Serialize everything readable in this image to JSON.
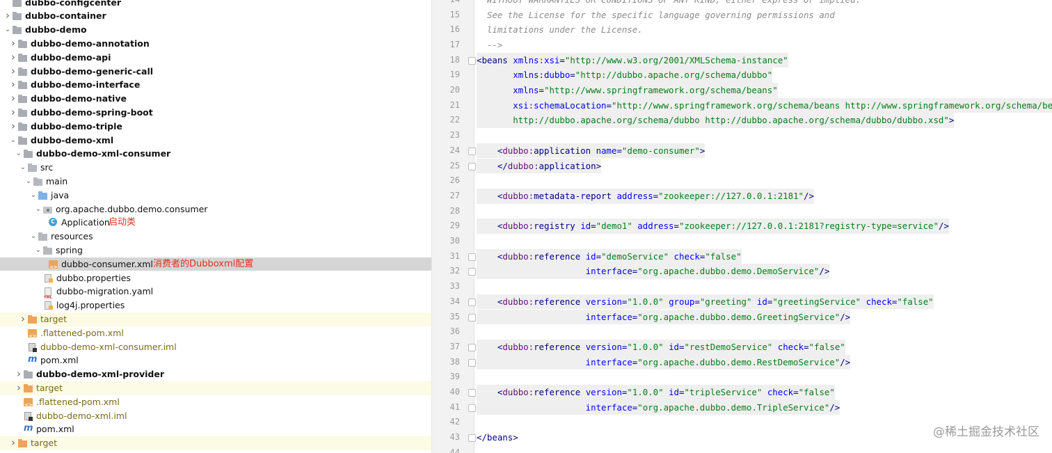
{
  "tree": {
    "rows": [
      {
        "label": "dubbo-configcenter",
        "bold": true
      },
      {
        "label": "dubbo-container",
        "bold": true
      },
      {
        "label": "dubbo-demo",
        "bold": true
      },
      {
        "label": "dubbo-demo-annotation",
        "bold": true
      },
      {
        "label": "dubbo-demo-api",
        "bold": true
      },
      {
        "label": "dubbo-demo-generic-call",
        "bold": true
      },
      {
        "label": "dubbo-demo-interface",
        "bold": true
      },
      {
        "label": "dubbo-demo-native",
        "bold": true
      },
      {
        "label": "dubbo-demo-spring-boot",
        "bold": true
      },
      {
        "label": "dubbo-demo-triple",
        "bold": true
      },
      {
        "label": "dubbo-demo-xml",
        "bold": true
      },
      {
        "label": "dubbo-demo-xml-consumer",
        "bold": true
      },
      {
        "label": "src"
      },
      {
        "label": "main"
      },
      {
        "label": "java"
      },
      {
        "label": "org.apache.dubbo.demo.consumer"
      },
      {
        "label": "Application",
        "note": "启动类"
      },
      {
        "label": "resources"
      },
      {
        "label": "spring"
      },
      {
        "label": "dubbo-consumer.xml",
        "note": "消费者的Dubboxml配置"
      },
      {
        "label": "dubbo.properties"
      },
      {
        "label": "dubbo-migration.yaml"
      },
      {
        "label": "log4j.properties"
      },
      {
        "label": "target"
      },
      {
        "label": ".flattened-pom.xml"
      },
      {
        "label": "dubbo-demo-xml-consumer.iml"
      },
      {
        "label": "pom.xml"
      },
      {
        "label": "dubbo-demo-xml-provider",
        "bold": true
      },
      {
        "label": "target"
      },
      {
        "label": ".flattened-pom.xml"
      },
      {
        "label": "dubbo-demo-xml.iml"
      },
      {
        "label": "pom.xml"
      },
      {
        "label": "target"
      }
    ]
  },
  "editor": {
    "line_numbers": [
      "15",
      "16",
      "17",
      "18",
      "19",
      "20",
      "21",
      "22",
      "23",
      "24",
      "25",
      "26",
      "27",
      "28",
      "29",
      "30",
      "31",
      "32",
      "33",
      "34",
      "35",
      "36",
      "37",
      "38",
      "39",
      "40",
      "41",
      "42",
      "43",
      "44"
    ],
    "top_partial_text": "WITHOUT WARRANTIES OR CONDITIONS OF ANY KIND, either express or implied.",
    "top_partial_number": "14",
    "lines": [
      [
        [
          "c",
          "  See the License for the specific language governing permissions and"
        ]
      ],
      [
        [
          "c",
          "  limitations under the License."
        ]
      ],
      [
        [
          "c",
          "  -->"
        ]
      ],
      [
        [
          "t",
          "<beans "
        ],
        [
          "a",
          "xmlns"
        ],
        [
          "ns",
          ":"
        ],
        [
          "a",
          "xsi"
        ],
        [
          "t",
          "="
        ],
        [
          "v",
          "\"http://www.w3.org/2001/XMLSchema-instance\""
        ]
      ],
      [
        [
          "t",
          "       "
        ],
        [
          "a",
          "xmlns:dubbo"
        ],
        [
          "t",
          "="
        ],
        [
          "v",
          "\"http://dubbo.apache.org/schema/dubbo\""
        ]
      ],
      [
        [
          "t",
          "       "
        ],
        [
          "a",
          "xmlns"
        ],
        [
          "t",
          "="
        ],
        [
          "v",
          "\"http://www.springframework.org/schema/beans\""
        ]
      ],
      [
        [
          "t",
          "       "
        ],
        [
          "a",
          "xsi"
        ],
        [
          "ns",
          ":"
        ],
        [
          "a",
          "schemaLocation"
        ],
        [
          "t",
          "="
        ],
        [
          "v",
          "\"http://www.springframework.org/schema/beans http://www.springframework.org/schema/beans/spring-beans.xsd"
        ]
      ],
      [
        [
          "v",
          "       http://dubbo.apache.org/schema/dubbo http://dubbo.apache.org/schema/dubbo/dubbo.xsd\""
        ],
        [
          "t",
          ">"
        ]
      ],
      [
        [
          "t",
          ""
        ]
      ],
      [
        [
          "t",
          "    <"
        ],
        [
          "ns",
          "dubbo:"
        ],
        [
          "t",
          "application "
        ],
        [
          "a",
          "name"
        ],
        [
          "t",
          "="
        ],
        [
          "v",
          "\"demo-consumer\""
        ],
        [
          "t",
          ">"
        ]
      ],
      [
        [
          "t",
          "    </"
        ],
        [
          "ns",
          "dubbo:"
        ],
        [
          "t",
          "application>"
        ]
      ],
      [
        [
          "t",
          ""
        ]
      ],
      [
        [
          "t",
          "    <"
        ],
        [
          "ns",
          "dubbo:"
        ],
        [
          "t",
          "metadata-report "
        ],
        [
          "a",
          "address"
        ],
        [
          "t",
          "="
        ],
        [
          "v",
          "\"zookeeper://127.0.0.1:2181\""
        ],
        [
          "t",
          "/>"
        ]
      ],
      [
        [
          "t",
          ""
        ]
      ],
      [
        [
          "t",
          "    <"
        ],
        [
          "ns",
          "dubbo:"
        ],
        [
          "t",
          "registry "
        ],
        [
          "a",
          "id"
        ],
        [
          "t",
          "="
        ],
        [
          "v",
          "\"demo1\""
        ],
        [
          "t",
          " "
        ],
        [
          "a",
          "address"
        ],
        [
          "t",
          "="
        ],
        [
          "v",
          "\"zookeeper://127.0.0.1:2181?registry-type=service\""
        ],
        [
          "t",
          "/>"
        ]
      ],
      [
        [
          "t",
          ""
        ]
      ],
      [
        [
          "t",
          "    <"
        ],
        [
          "ns",
          "dubbo:"
        ],
        [
          "t",
          "reference "
        ],
        [
          "a",
          "id"
        ],
        [
          "t",
          "="
        ],
        [
          "v",
          "\"demoService\""
        ],
        [
          "t",
          " "
        ],
        [
          "a",
          "check"
        ],
        [
          "t",
          "="
        ],
        [
          "v",
          "\"false\""
        ]
      ],
      [
        [
          "t",
          "                     "
        ],
        [
          "a",
          "interface"
        ],
        [
          "t",
          "="
        ],
        [
          "v",
          "\"org.apache.dubbo.demo.DemoService\""
        ],
        [
          "t",
          "/>"
        ]
      ],
      [
        [
          "t",
          ""
        ]
      ],
      [
        [
          "t",
          "    <"
        ],
        [
          "ns",
          "dubbo:"
        ],
        [
          "t",
          "reference "
        ],
        [
          "a",
          "version"
        ],
        [
          "t",
          "="
        ],
        [
          "v",
          "\"1.0.0\""
        ],
        [
          "t",
          " "
        ],
        [
          "a",
          "group"
        ],
        [
          "t",
          "="
        ],
        [
          "v",
          "\"greeting\""
        ],
        [
          "t",
          " "
        ],
        [
          "a",
          "id"
        ],
        [
          "t",
          "="
        ],
        [
          "v",
          "\"greetingService\""
        ],
        [
          "t",
          " "
        ],
        [
          "a",
          "check"
        ],
        [
          "t",
          "="
        ],
        [
          "v",
          "\"false\""
        ]
      ],
      [
        [
          "t",
          "                     "
        ],
        [
          "a",
          "interface"
        ],
        [
          "t",
          "="
        ],
        [
          "v",
          "\"org.apache.dubbo.demo.GreetingService\""
        ],
        [
          "t",
          "/>"
        ]
      ],
      [
        [
          "t",
          ""
        ]
      ],
      [
        [
          "t",
          "    <"
        ],
        [
          "ns",
          "dubbo:"
        ],
        [
          "t",
          "reference "
        ],
        [
          "a",
          "version"
        ],
        [
          "t",
          "="
        ],
        [
          "v",
          "\"1.0.0\""
        ],
        [
          "t",
          " "
        ],
        [
          "a",
          "id"
        ],
        [
          "t",
          "="
        ],
        [
          "v",
          "\"restDemoService\""
        ],
        [
          "t",
          " "
        ],
        [
          "a",
          "check"
        ],
        [
          "t",
          "="
        ],
        [
          "v",
          "\"false\""
        ]
      ],
      [
        [
          "t",
          "                     "
        ],
        [
          "a",
          "interface"
        ],
        [
          "t",
          "="
        ],
        [
          "v",
          "\"org.apache.dubbo.demo.RestDemoService\""
        ],
        [
          "t",
          "/>"
        ]
      ],
      [
        [
          "t",
          ""
        ]
      ],
      [
        [
          "t",
          "    <"
        ],
        [
          "ns",
          "dubbo:"
        ],
        [
          "t",
          "reference "
        ],
        [
          "a",
          "version"
        ],
        [
          "t",
          "="
        ],
        [
          "v",
          "\"1.0.0\""
        ],
        [
          "t",
          " "
        ],
        [
          "a",
          "id"
        ],
        [
          "t",
          "="
        ],
        [
          "v",
          "\"tripleService\""
        ],
        [
          "t",
          " "
        ],
        [
          "a",
          "check"
        ],
        [
          "t",
          "="
        ],
        [
          "v",
          "\"false\""
        ]
      ],
      [
        [
          "t",
          "                     "
        ],
        [
          "a",
          "interface"
        ],
        [
          "t",
          "="
        ],
        [
          "v",
          "\"org.apache.dubbo.demo.TripleService\""
        ],
        [
          "t",
          "/>"
        ]
      ],
      [
        [
          "t",
          ""
        ]
      ],
      [
        [
          "t",
          "</beans>"
        ]
      ],
      [
        [
          "t",
          ""
        ]
      ]
    ]
  },
  "watermark": "@稀土掘金技术社区"
}
